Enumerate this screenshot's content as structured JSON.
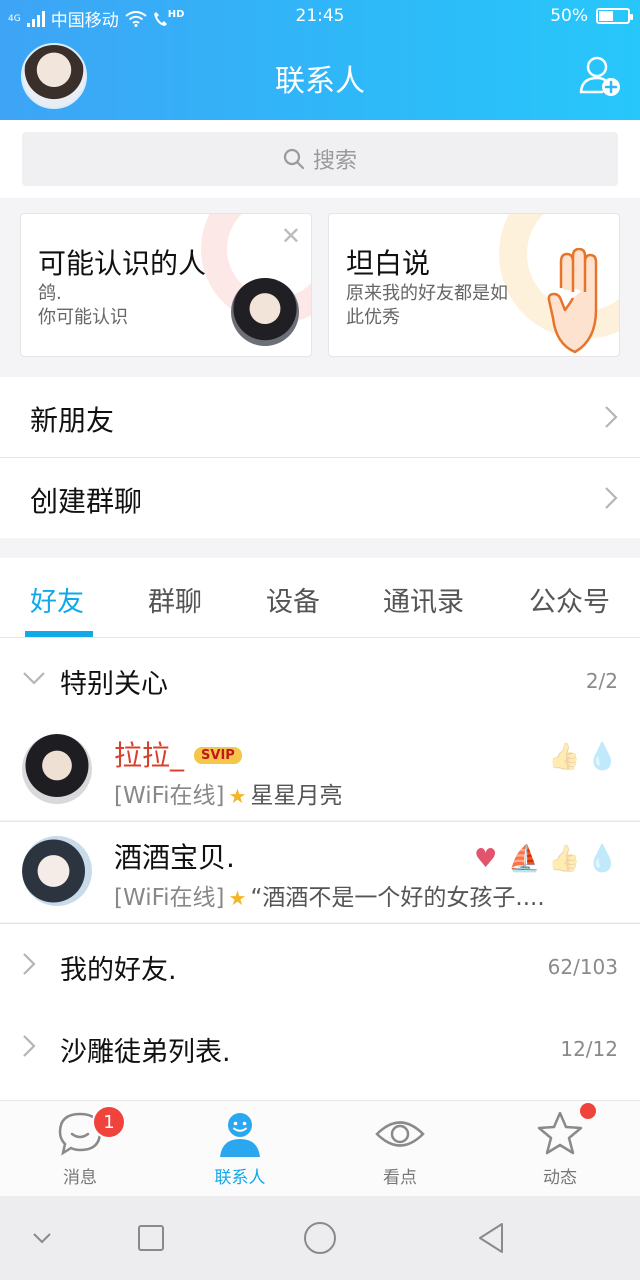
{
  "status_bar": {
    "network_tag": "4G",
    "carrier": "中国移动",
    "hd_tag": "HD",
    "time": "21:45",
    "battery_percent": "50%",
    "battery_level": 0.5
  },
  "header": {
    "title": "联系人"
  },
  "search": {
    "placeholder": "搜索"
  },
  "cards": [
    {
      "title": "可能认识的人",
      "line1": "鸽.",
      "line2": "你可能认识"
    },
    {
      "title": "坦白说",
      "line1": "原来我的好友都是如",
      "line2": "此优秀"
    }
  ],
  "menu": {
    "new_friends": "新朋友",
    "create_group": "创建群聊"
  },
  "tabs": [
    "好友",
    "群聊",
    "设备",
    "通讯录",
    "公众号"
  ],
  "special_group": {
    "title": "特别关心",
    "count": "2/2"
  },
  "contacts": [
    {
      "name": "拉拉_",
      "badge": "SVIP",
      "status_prefix": "[WiFi在线]",
      "message": "星星月亮"
    },
    {
      "name": "酒酒宝贝.",
      "status_prefix": "[WiFi在线]",
      "message": "“酒酒不是一个好的女孩子...."
    }
  ],
  "groups": [
    {
      "title": "我的好友.",
      "count": "62/103"
    },
    {
      "title": "沙雕徒弟列表.",
      "count": "12/12"
    }
  ],
  "bottom_nav": [
    {
      "label": "消息",
      "badge": "1"
    },
    {
      "label": "联系人"
    },
    {
      "label": "看点"
    },
    {
      "label": "动态"
    }
  ],
  "colors": {
    "accent": "#12a8ea",
    "header_start": "#3ea4f6",
    "header_end": "#27c7fa",
    "badge_red": "#f0433b"
  },
  "icons": [
    "signal-icon",
    "wifi-icon",
    "call-hd-icon",
    "battery-icon",
    "add-friend-icon",
    "search-icon",
    "close-icon",
    "hand-icon",
    "chevron-right-icon",
    "chevron-down-icon",
    "star-icon",
    "thumbs-up-icon",
    "heart-icon",
    "sailboat-icon",
    "message-icon",
    "contacts-icon",
    "eye-icon",
    "star-outline-icon",
    "back-triangle-icon",
    "home-circle-icon",
    "recent-square-icon"
  ]
}
